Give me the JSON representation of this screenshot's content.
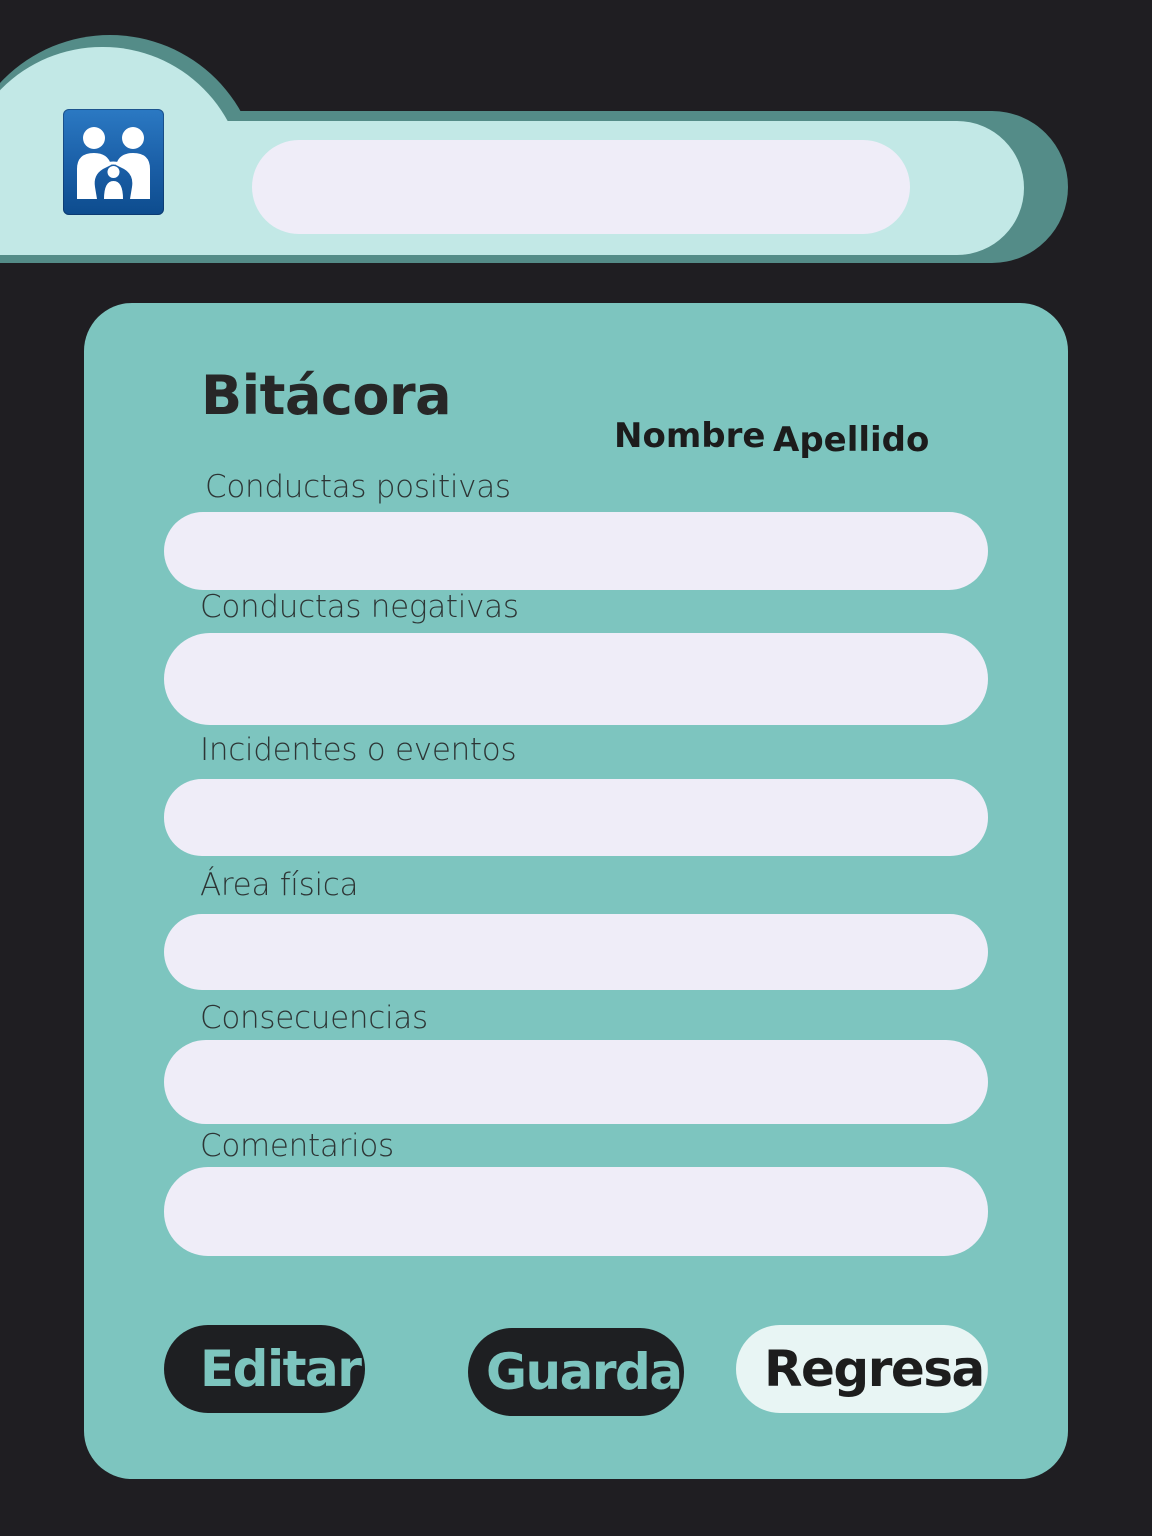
{
  "header": {
    "logo_icon": "family-logo-icon",
    "search_value": "",
    "colors": {
      "header_light": "#c2e8e6",
      "header_dark": "#548c88",
      "logo_blue": "#1a5ea6"
    }
  },
  "form": {
    "title": "Bitácora",
    "student": {
      "first_name": "Nombre",
      "last_name": "Apellido"
    },
    "fields": [
      {
        "label": "Conductas positivas",
        "value": ""
      },
      {
        "label": "Conductas negativas",
        "value": ""
      },
      {
        "label": "Incidentes o eventos",
        "value": ""
      },
      {
        "label": "Área física",
        "value": ""
      },
      {
        "label": "Consecuencias",
        "value": ""
      },
      {
        "label": "Comentarios",
        "value": ""
      }
    ],
    "buttons": {
      "edit": "Editar",
      "save": "Guardar",
      "back": "Regresar"
    },
    "colors": {
      "card_bg": "#7dc5bf",
      "input_bg": "#efedf8",
      "dark_button": "#1e1f22",
      "light_button": "#e8f5f4",
      "page_bg": "#1f1e22"
    }
  }
}
